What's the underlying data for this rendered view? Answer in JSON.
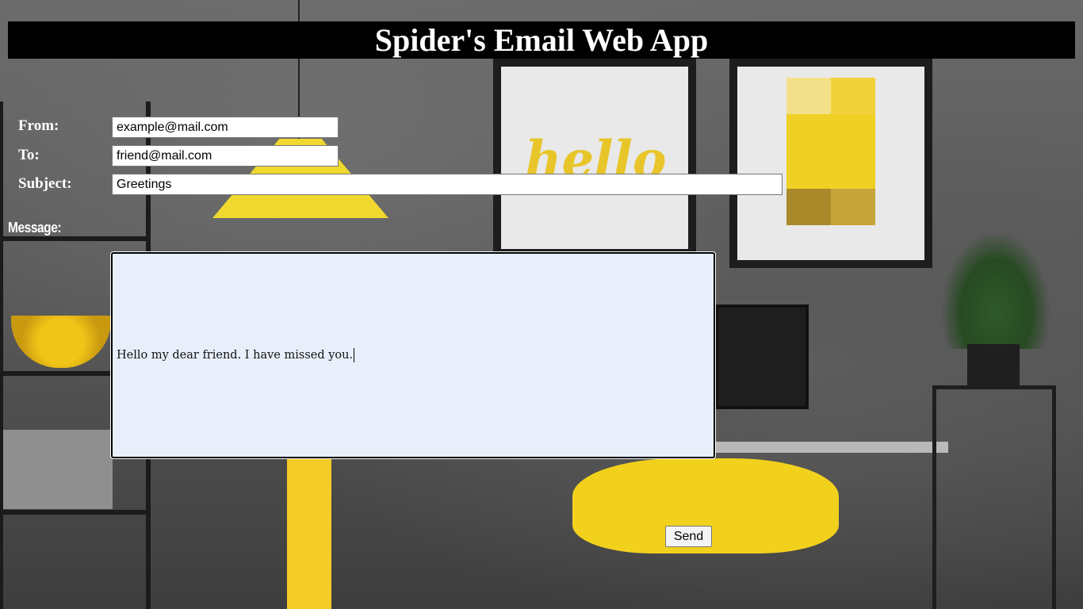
{
  "app": {
    "title": "Spider's Email Web App"
  },
  "form": {
    "from_label": "From:",
    "from_value": "example@mail.com",
    "to_label": "To:",
    "to_value": "friend@mail.com",
    "subject_label": "Subject:",
    "subject_value": "Greetings",
    "message_label": "Message:",
    "message_value": "Hello my dear friend. I have missed you.",
    "send_label": "Send"
  },
  "colors": {
    "title_bar_bg": "#000000",
    "title_text": "#ffffff",
    "label_text": "#ffffff",
    "message_bg": "#e8effb"
  }
}
